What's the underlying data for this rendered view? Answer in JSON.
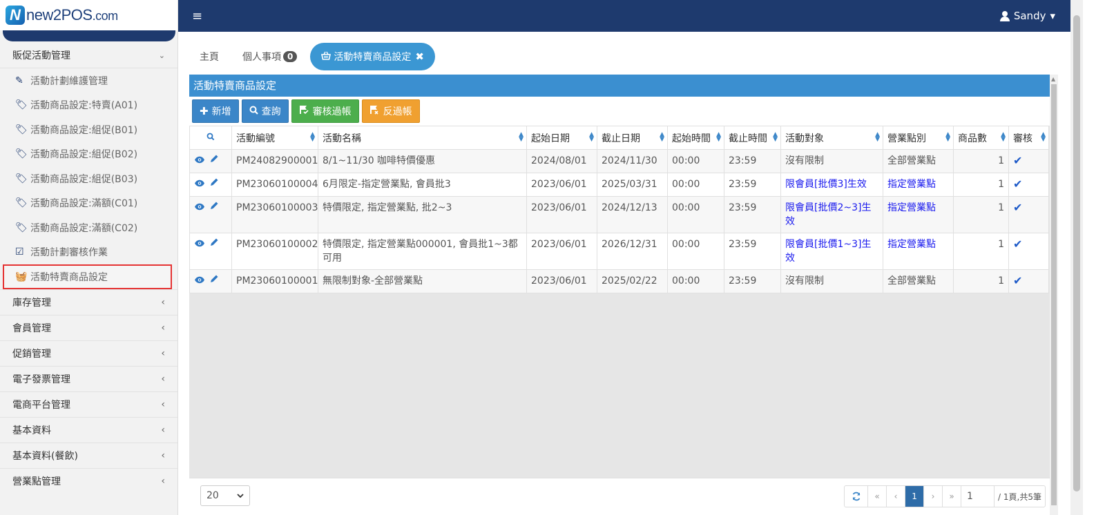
{
  "logo": {
    "badge": "N",
    "text": "new2POS",
    "suffix": ".com"
  },
  "sidebar": {
    "group_label": "販促活動管理",
    "sub_items": [
      {
        "icon": "✎",
        "label": "活動計劃維護管理"
      },
      {
        "icon": "🏷",
        "label": "活動商品設定:特賣(A01)"
      },
      {
        "icon": "🏷",
        "label": "活動商品設定:組促(B01)"
      },
      {
        "icon": "🏷",
        "label": "活動商品設定:組促(B02)"
      },
      {
        "icon": "🏷",
        "label": "活動商品設定:組促(B03)"
      },
      {
        "icon": "🏷",
        "label": "活動商品設定:滿額(C01)"
      },
      {
        "icon": "🏷",
        "label": "活動商品設定:滿額(C02)"
      },
      {
        "icon": "☑",
        "label": "活動計劃審核作業"
      },
      {
        "icon": "🧺",
        "label": "活動特賣商品設定"
      }
    ],
    "collapsed_groups": [
      "庫存管理",
      "會員管理",
      "促銷管理",
      "電子發票管理",
      "電商平台管理",
      "基本資料",
      "基本資料(餐飲)",
      "營業點管理"
    ],
    "chevron_down": "⌄",
    "chevron_left": "‹"
  },
  "topbar": {
    "menu_icon": "≡",
    "user": "Sandy",
    "caret": "▾"
  },
  "tabs": {
    "home": "主頁",
    "personal": "個人事項",
    "personal_count": "0",
    "active": "活動特賣商品設定",
    "close": "✖"
  },
  "panel": {
    "title": "活動特賣商品設定",
    "buttons": {
      "add": "新增",
      "query": "查詢",
      "approve": "審核過帳",
      "unapprove": "反過帳"
    }
  },
  "table": {
    "headers": [
      "活動編號",
      "活動名稱",
      "起始日期",
      "截止日期",
      "起始時間",
      "截止時間",
      "活動對象",
      "營業點別",
      "商品數",
      "審核"
    ],
    "rows": [
      {
        "id": "PM24082900001",
        "name": "8/1~11/30 咖啡特價優惠",
        "start_date": "2024/08/01",
        "end_date": "2024/11/30",
        "start_time": "00:00",
        "end_time": "23:59",
        "target": "沒有限制",
        "store": "全部營業點",
        "count": "1",
        "approved": "✔"
      },
      {
        "id": "PM23060100004",
        "name": "6月限定-指定營業點, 會員批3",
        "start_date": "2023/06/01",
        "end_date": "2025/03/31",
        "start_time": "00:00",
        "end_time": "23:59",
        "target": "限會員[批價3]生效",
        "store": "指定營業點",
        "count": "1",
        "approved": "✔"
      },
      {
        "id": "PM23060100003",
        "name": "特價限定, 指定營業點, 批2~3",
        "start_date": "2023/06/01",
        "end_date": "2024/12/13",
        "start_time": "00:00",
        "end_time": "23:59",
        "target": "限會員[批價2~3]生效",
        "store": "指定營業點",
        "count": "1",
        "approved": "✔"
      },
      {
        "id": "PM23060100002",
        "name": "特價限定, 指定營業點000001, 會員批1~3都可用",
        "start_date": "2023/06/01",
        "end_date": "2026/12/31",
        "start_time": "00:00",
        "end_time": "23:59",
        "target": "限會員[批價1~3]生效",
        "store": "指定營業點",
        "count": "1",
        "approved": "✔"
      },
      {
        "id": "PM23060100001",
        "name": "無限制對象-全部營業點",
        "start_date": "2023/06/01",
        "end_date": "2025/02/22",
        "start_time": "00:00",
        "end_time": "23:59",
        "target": "沒有限制",
        "store": "全部營業點",
        "count": "1",
        "approved": "✔"
      }
    ]
  },
  "footer": {
    "page_size": "20",
    "first": "«",
    "prev": "‹",
    "page": "1",
    "next": "›",
    "last": "»",
    "page_input": "1",
    "info": "/ 1頁,共5筆"
  }
}
